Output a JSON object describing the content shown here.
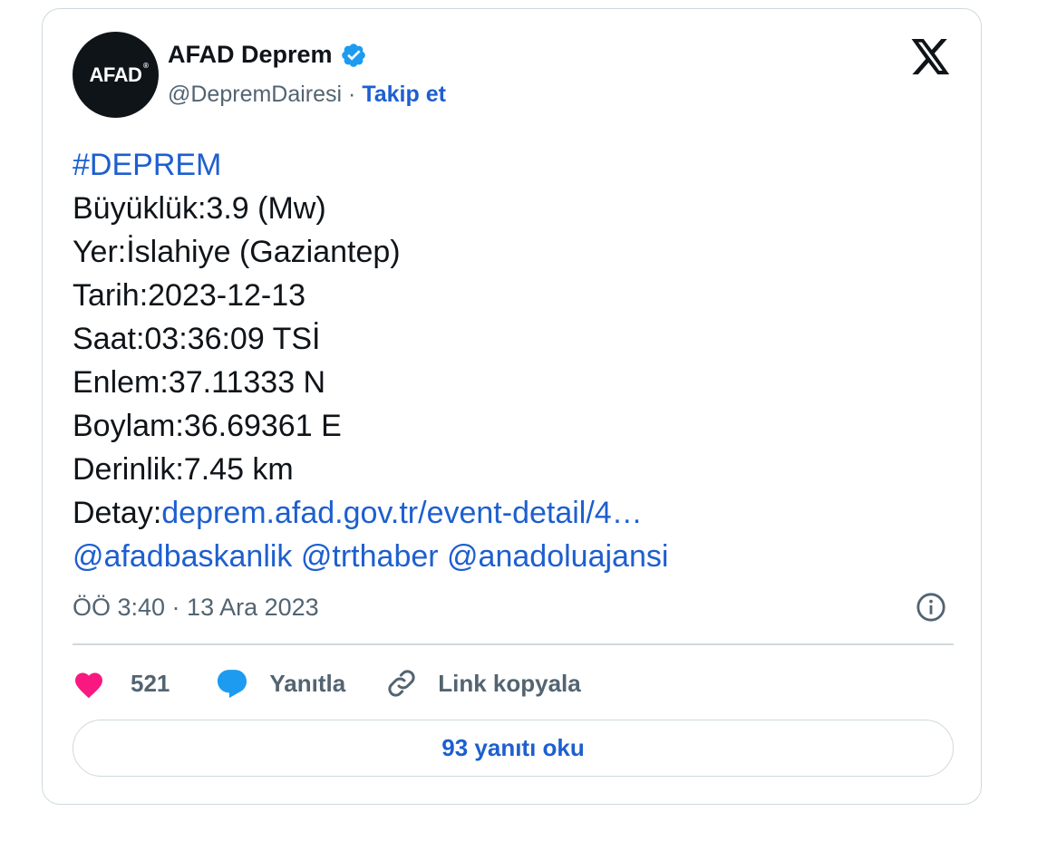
{
  "author": {
    "avatar_text": "AFAD",
    "avatar_reg": "®",
    "display_name": "AFAD Deprem",
    "handle": "@DepremDairesi",
    "separator": " · ",
    "follow_label": "Takip et",
    "verified_color": "#1d9bf0"
  },
  "tweet": {
    "hashtag": "#DEPREM",
    "lines": [
      "Büyüklük:3.9 (Mw)",
      "Yer:İslahiye (Gaziantep)",
      "Tarih:2023-12-13",
      "Saat:03:36:09 TSİ",
      "Enlem:37.11333 N",
      "Boylam:36.69361 E",
      "Derinlik:7.45 km"
    ],
    "detail_prefix": "Detay:",
    "detail_link": "deprem.afad.gov.tr/event-detail/4…",
    "mentions": [
      "@afadbaskanlik",
      "@trthaber",
      "@anadoluajansi"
    ],
    "timestamp": "ÖÖ 3:40 · 13 Ara 2023"
  },
  "actions": {
    "like_count": "521",
    "reply_label": "Yanıtla",
    "copy_link_label": "Link kopyala"
  },
  "read_replies_label": "93 yanıtı oku",
  "colors": {
    "link": "#1d5fcf",
    "like": "#f91880",
    "reply": "#1d9bf0",
    "muted": "#536471",
    "text": "#0f1419",
    "border": "#cfd9de"
  }
}
